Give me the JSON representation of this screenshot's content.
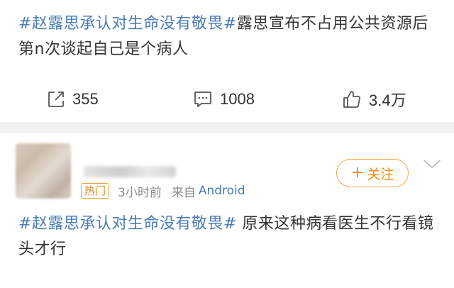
{
  "post1": {
    "hashtag": "#赵露思承认对生命没有敬畏#",
    "text": "露思宣布不占用公共资源后第n次谈起自己是个病人",
    "actions": {
      "repost_count": "355",
      "comment_count": "1008",
      "like_count": "3.4万"
    }
  },
  "post2": {
    "badge": "热门",
    "time": "3小时前",
    "source_prefix": "来自",
    "device": "Android",
    "follow_label": "关注",
    "follow_plus": "+",
    "hashtag": "#赵露思承认对生命没有敬畏#",
    "text": " 原来这种病看医生不行看镜头才行"
  },
  "colors": {
    "link_blue": "#4a7bb5",
    "follow_orange": "#f08a14",
    "divider_gray": "#f1f1f1"
  }
}
